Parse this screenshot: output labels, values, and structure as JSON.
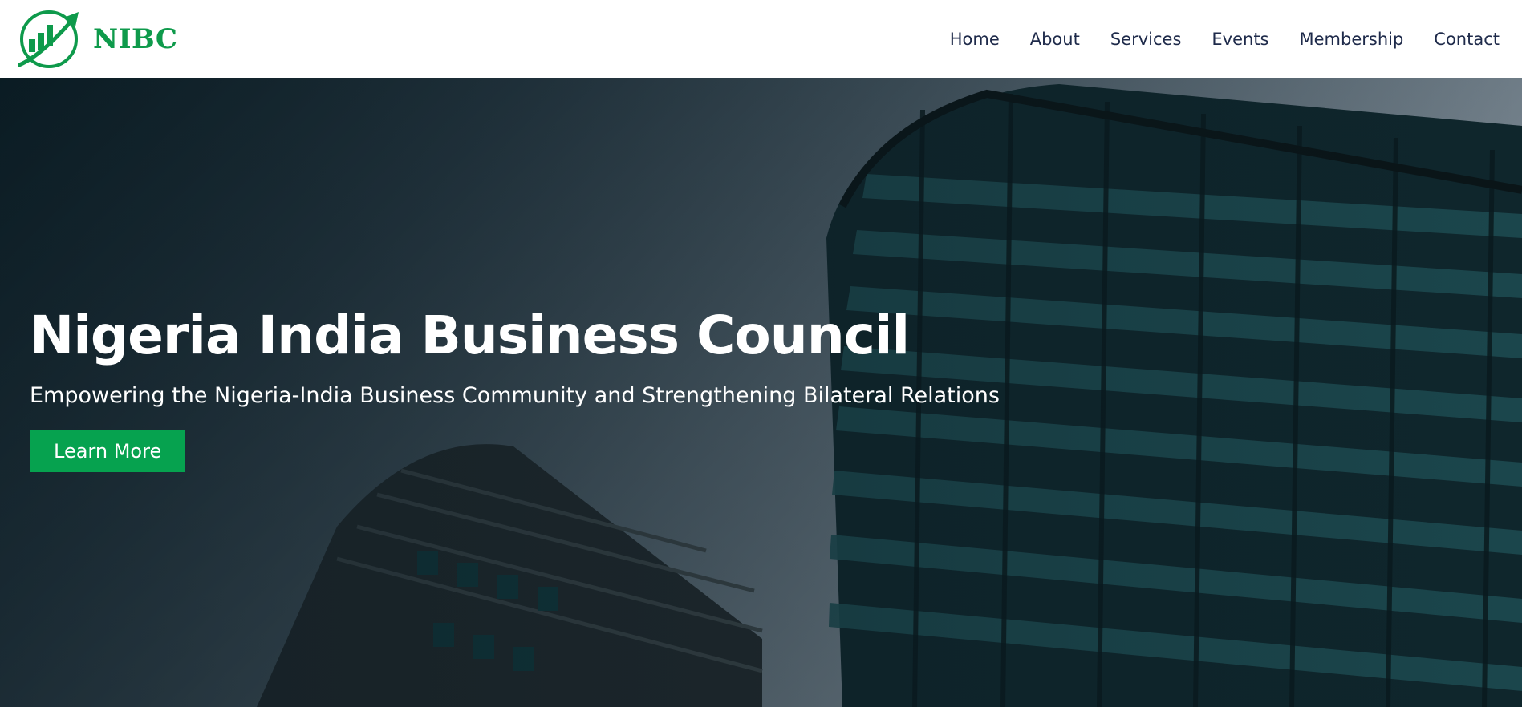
{
  "brand": {
    "name": "NIBC",
    "logo_icon": "growth-chart-circle-icon",
    "color": "#0e9a4b"
  },
  "nav": {
    "items": [
      {
        "label": "Home"
      },
      {
        "label": "About"
      },
      {
        "label": "Services"
      },
      {
        "label": "Events"
      },
      {
        "label": "Membership"
      },
      {
        "label": "Contact"
      }
    ],
    "color": "#1e2a4a"
  },
  "hero": {
    "title": "Nigeria India Business Council",
    "subtitle": "Empowering the Nigeria-India Business Community and Strengthening Bilateral Relations",
    "cta_label": "Learn More",
    "cta_color": "#06a24f",
    "background": "office-buildings-photo"
  }
}
